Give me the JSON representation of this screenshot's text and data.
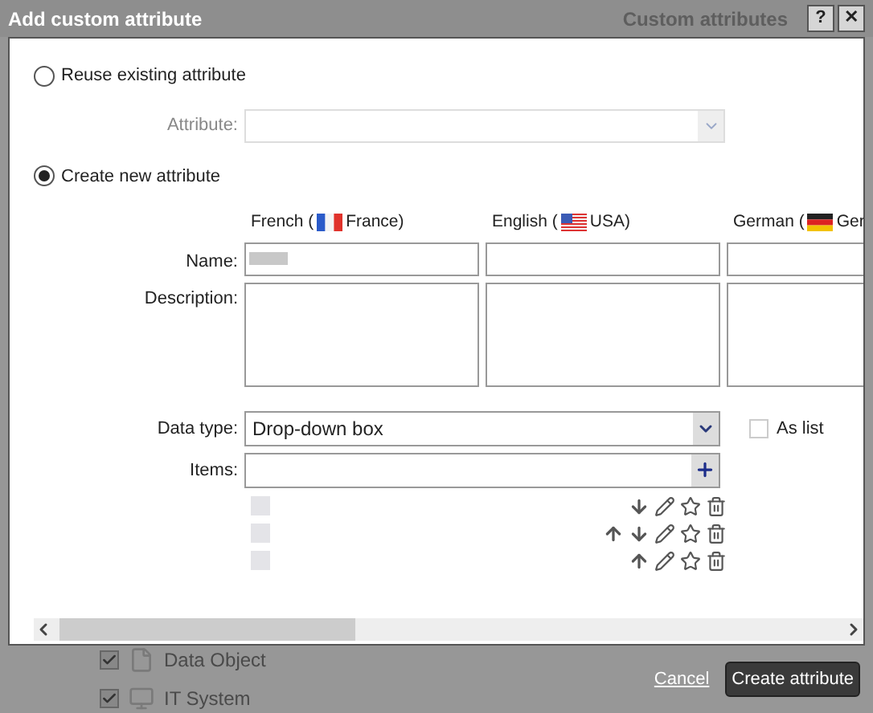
{
  "background": {
    "tab": "Custom attributes",
    "items": [
      {
        "label": "Data Object",
        "checked": true,
        "kind": "document"
      },
      {
        "label": "IT System",
        "checked": true,
        "kind": "computer"
      }
    ]
  },
  "dialog": {
    "title": "Add custom attribute",
    "help": "?",
    "close": "✕"
  },
  "options": [
    {
      "label": "Reuse existing attribute",
      "selected": false
    },
    {
      "label": "Create new attribute",
      "selected": true
    }
  ],
  "attribute_field": {
    "label": "Attribute:",
    "disabled": true
  },
  "languages": [
    {
      "name": "French (",
      "region": "France)",
      "kind": "fr"
    },
    {
      "name": "English (",
      "region": "USA)",
      "kind": "us"
    },
    {
      "name": "German (",
      "region": "Ger",
      "kind": "de"
    }
  ],
  "name_label": "Name:",
  "description_label": "Description:",
  "name_values_redacted": [
    true,
    false,
    false
  ],
  "data_type": {
    "label": "Data type:",
    "value": "Drop-down box"
  },
  "as_list": {
    "label": "As list",
    "checked": false
  },
  "items_field": {
    "label": "Items:"
  },
  "items": [
    {
      "can_move_up": false,
      "can_move_down": true
    },
    {
      "can_move_up": true,
      "can_move_down": true
    },
    {
      "can_move_up": true,
      "can_move_down": false
    }
  ],
  "footer": {
    "cancel": "Cancel",
    "submit": "Create attribute"
  }
}
